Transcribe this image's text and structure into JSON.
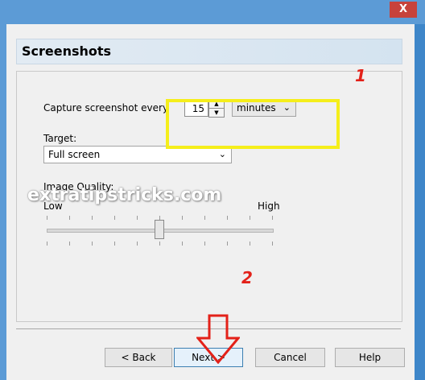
{
  "window": {
    "close_label": "X"
  },
  "header": {
    "title": "Screenshots"
  },
  "capture": {
    "label": "Capture screenshot every",
    "interval_value": "15",
    "unit_selected": "minutes"
  },
  "target": {
    "label": "Target:",
    "selected": "Full screen"
  },
  "quality": {
    "label": "Image Quality:",
    "low_label": "Low",
    "high_label": "High",
    "level_fraction": 0.5
  },
  "buttons": {
    "back": "< Back",
    "next": "Next >",
    "cancel": "Cancel",
    "help": "Help"
  },
  "annotations": {
    "step1": "1",
    "step2": "2",
    "watermark": "extratipstricks.com",
    "accent_red": "#e32119",
    "highlight_yellow": "#f5ee1b"
  }
}
